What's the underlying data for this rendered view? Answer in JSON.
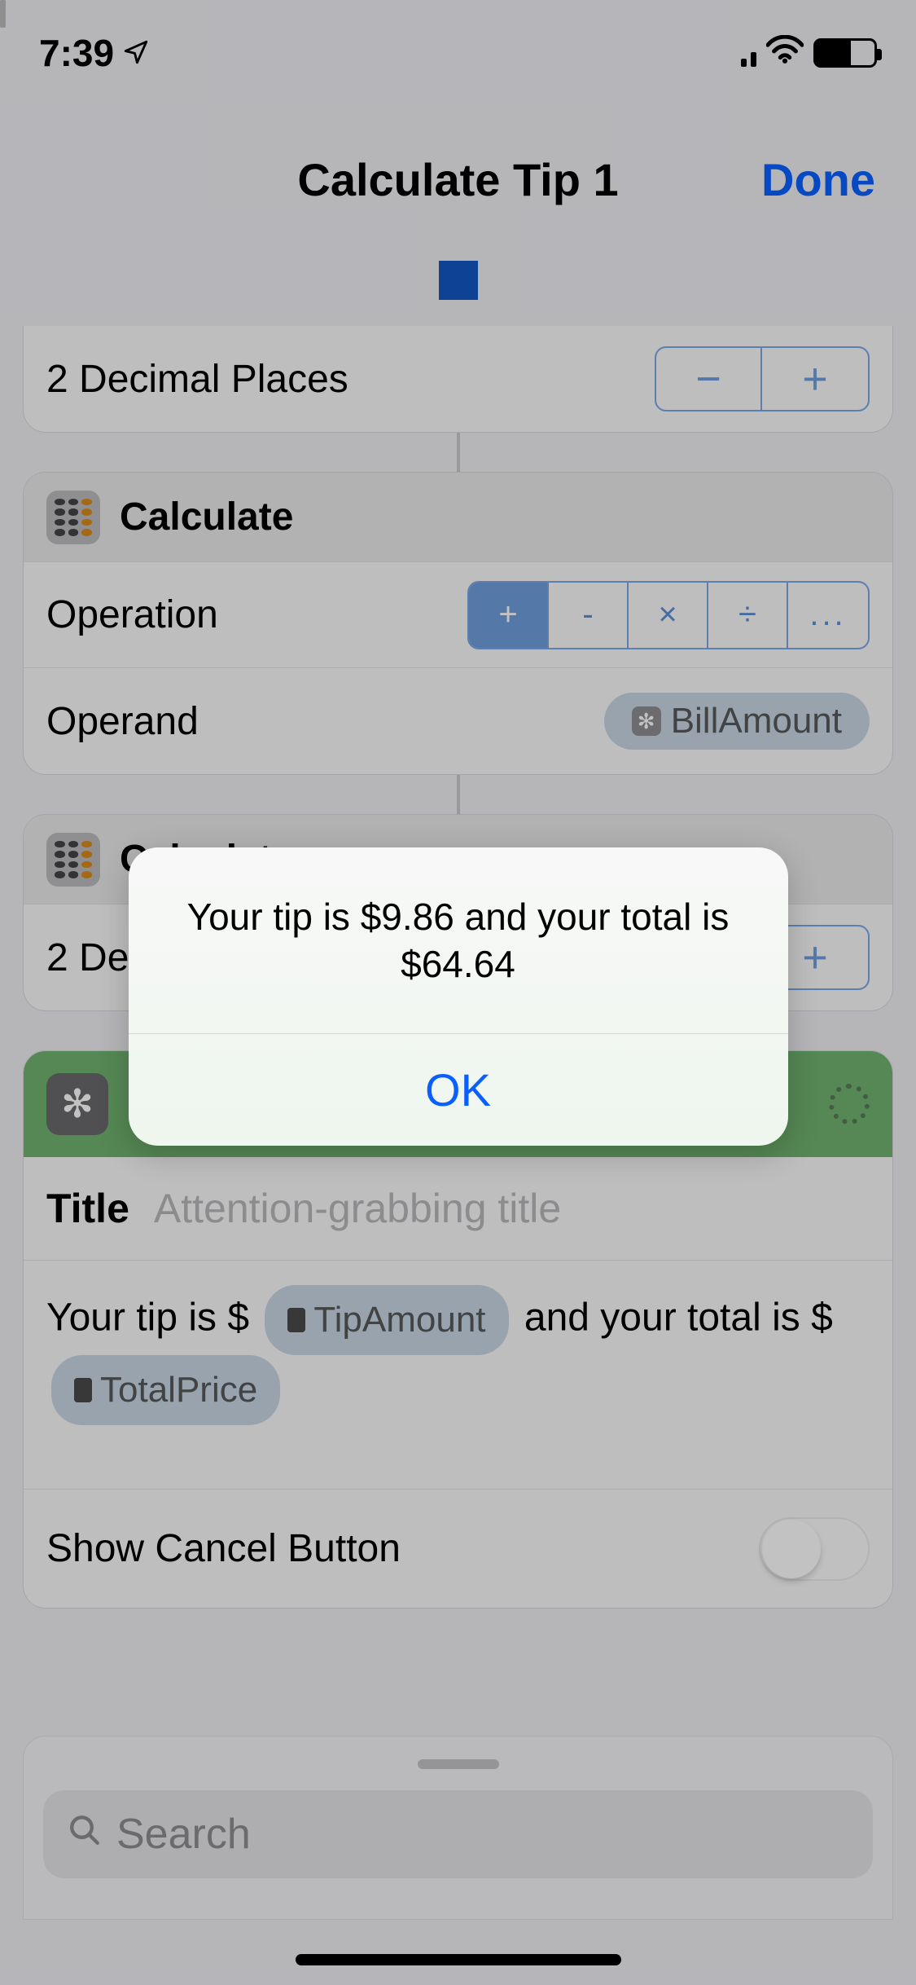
{
  "status": {
    "time": "7:39"
  },
  "header": {
    "title": "Calculate Tip 1",
    "done": "Done"
  },
  "decimal_row": {
    "label": "2 Decimal Places"
  },
  "calculate_card": {
    "header": "Calculate",
    "operation_label": "Operation",
    "operations": [
      "+",
      "-",
      "×",
      "÷",
      "..."
    ],
    "selected_op_index": 0,
    "operand_label": "Operand",
    "operand_var": "BillAmount"
  },
  "calculate_card2": {
    "header": "Calculate",
    "decimal_label": "2 Decimal Places"
  },
  "alert_action": {
    "title_label": "Title",
    "title_placeholder": "Attention-grabbing title",
    "msg_pre": "Your tip is $",
    "var1": "TipAmount",
    "msg_mid": " and your total is $",
    "var2": "TotalPrice",
    "cancel_label": "Show Cancel Button"
  },
  "search": {
    "placeholder": "Search"
  },
  "alert": {
    "message": "Your tip is $9.86 and your total is $64.64",
    "ok": "OK"
  }
}
